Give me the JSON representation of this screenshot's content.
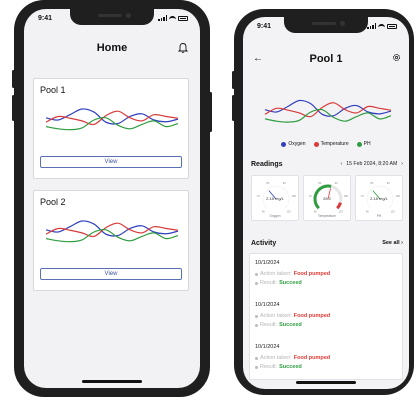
{
  "home": {
    "status_time": "9:41",
    "title": "Home",
    "pools": [
      {
        "name": "Pool 1",
        "button": "View"
      },
      {
        "name": "Pool 2",
        "button": "View"
      }
    ]
  },
  "detail": {
    "status_time": "9:41",
    "title": "Pool 1",
    "legend": [
      {
        "label": "Oxygen",
        "color": "#2f3fc0"
      },
      {
        "label": "Temperature",
        "color": "#d93b3b"
      },
      {
        "label": "PH",
        "color": "#2e9d3f"
      }
    ],
    "readings_title": "Readings",
    "date_range": "15 Feb 2024, 8:20 AM",
    "readings": [
      {
        "value": "2.18 mg/L",
        "label": "Oxygen",
        "level": 0.35,
        "accent": "#2f3fc0"
      },
      {
        "value": "26.2",
        "label": "Temperature",
        "level": 0.55,
        "accent": "#d93b3b"
      },
      {
        "value": "2.18 mg/L",
        "label": "PH",
        "level": 0.35,
        "accent": "#2e9d3f"
      }
    ],
    "gauge_ticks": [
      "60",
      "70",
      "80",
      "90",
      "100",
      "110"
    ],
    "activity_title": "Activity",
    "see_all": "See all",
    "activities": [
      {
        "date": "10/1/2024",
        "action_key": "Action taken:",
        "action_value": "Food pumped",
        "result_key": "Result:",
        "result_value": "Succeed"
      },
      {
        "date": "10/1/2024",
        "action_key": "Action taken:",
        "action_value": "Food pumped",
        "result_key": "Result:",
        "result_value": "Succeed"
      },
      {
        "date": "10/1/2024",
        "action_key": "Action taken:",
        "action_value": "Food pumped",
        "result_key": "Result:",
        "result_value": "Succeed"
      }
    ]
  },
  "chart_data": {
    "type": "line",
    "x": [
      0,
      1,
      2,
      3,
      4,
      5,
      6,
      7,
      8,
      9,
      10,
      11
    ],
    "series": [
      {
        "values": [
          55,
          50,
          62,
          75,
          68,
          45,
          42,
          58,
          64,
          50,
          46,
          52
        ]
      },
      {
        "values": [
          45,
          58,
          54,
          48,
          40,
          60,
          70,
          55,
          48,
          62,
          58,
          54
        ]
      },
      {
        "values": [
          35,
          30,
          28,
          32,
          50,
          55,
          38,
          30,
          40,
          48,
          35,
          42
        ]
      }
    ],
    "colors": [
      "#2f3fc0",
      "#d93b3b",
      "#2e9d3f"
    ],
    "grid": false,
    "ylim": [
      0,
      100
    ]
  }
}
